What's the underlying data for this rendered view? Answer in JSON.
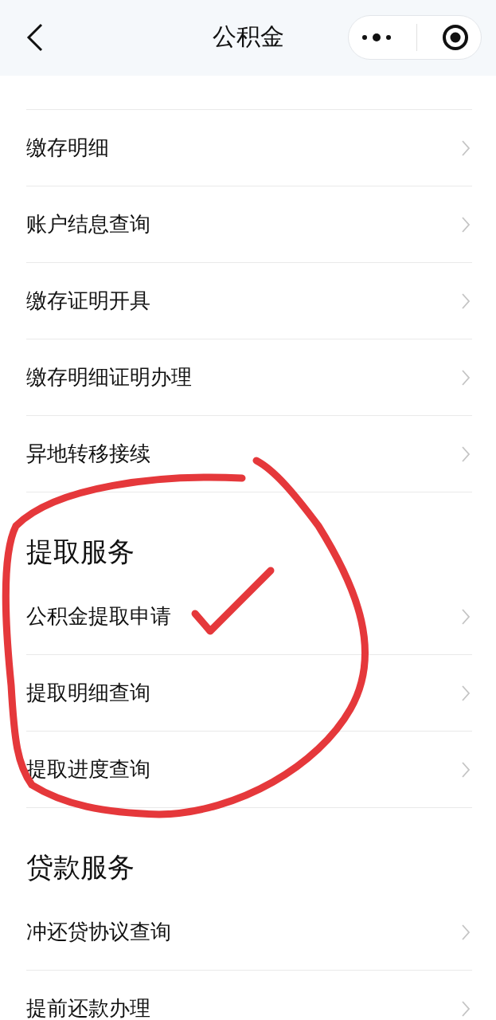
{
  "header": {
    "title": "公积金"
  },
  "sections": [
    {
      "items": [
        "缴存明细",
        "账户结息查询",
        "缴存证明开具",
        "缴存明细证明办理",
        "异地转移接续"
      ]
    },
    {
      "title": "提取服务",
      "items": [
        "公积金提取申请",
        "提取明细查询",
        "提取进度查询"
      ]
    },
    {
      "title": "贷款服务",
      "items": [
        "冲还贷协议查询",
        "提前还款办理"
      ]
    }
  ]
}
